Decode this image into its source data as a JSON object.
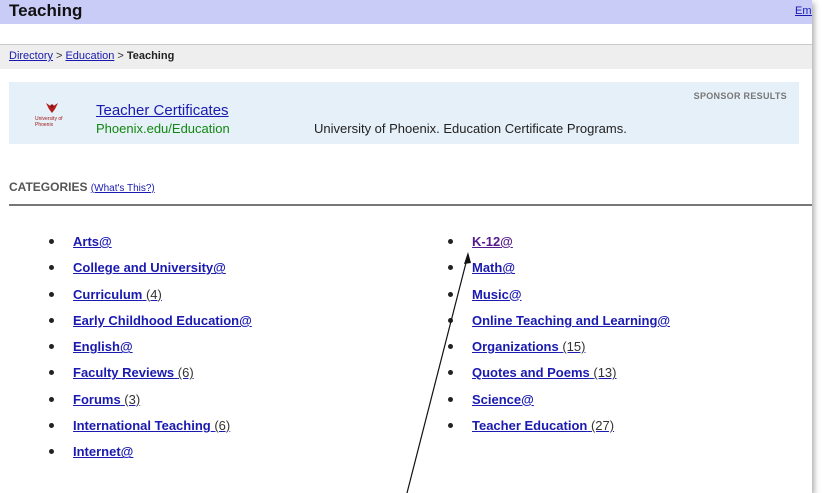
{
  "header": {
    "title": "Teaching",
    "email_link": "Ema"
  },
  "breadcrumb": {
    "items": [
      "Directory",
      "Education"
    ],
    "separator": ">",
    "current": "Teaching"
  },
  "sponsor": {
    "label": "SPONSOR RESULTS",
    "logo_text": "University of Phoenix",
    "ad_title": "Teacher Certificates",
    "ad_url": "Phoenix.edu/Education",
    "ad_description": "University of Phoenix. Education Certificate Programs."
  },
  "categories": {
    "heading": "CATEGORIES",
    "whats_this": "(What's This?)",
    "left": [
      {
        "label": "Arts@",
        "count": ""
      },
      {
        "label": "College and University@",
        "count": ""
      },
      {
        "label": "Curriculum",
        "count": "(4)"
      },
      {
        "label": "Early Childhood Education@",
        "count": ""
      },
      {
        "label": "English@",
        "count": ""
      },
      {
        "label": "Faculty Reviews",
        "count": "(6)"
      },
      {
        "label": "Forums",
        "count": "(3)"
      },
      {
        "label": "International Teaching",
        "count": "(6)"
      },
      {
        "label": "Internet@",
        "count": ""
      }
    ],
    "right": [
      {
        "label": "K-12@",
        "count": "",
        "visited": true
      },
      {
        "label": "Math@",
        "count": ""
      },
      {
        "label": "Music@",
        "count": ""
      },
      {
        "label": "Online Teaching and Learning@",
        "count": ""
      },
      {
        "label": "Organizations",
        "count": "(15)"
      },
      {
        "label": "Quotes and Poems",
        "count": "(13)"
      },
      {
        "label": "Science@",
        "count": ""
      },
      {
        "label": "Teacher Education",
        "count": "(27)"
      }
    ]
  },
  "colors": {
    "titlebar": "#c9ccf6",
    "link": "#1a1ab0",
    "visited_link": "#551a8b",
    "ad_url": "#118811",
    "sponsor_bg": "#e6f0f8"
  }
}
